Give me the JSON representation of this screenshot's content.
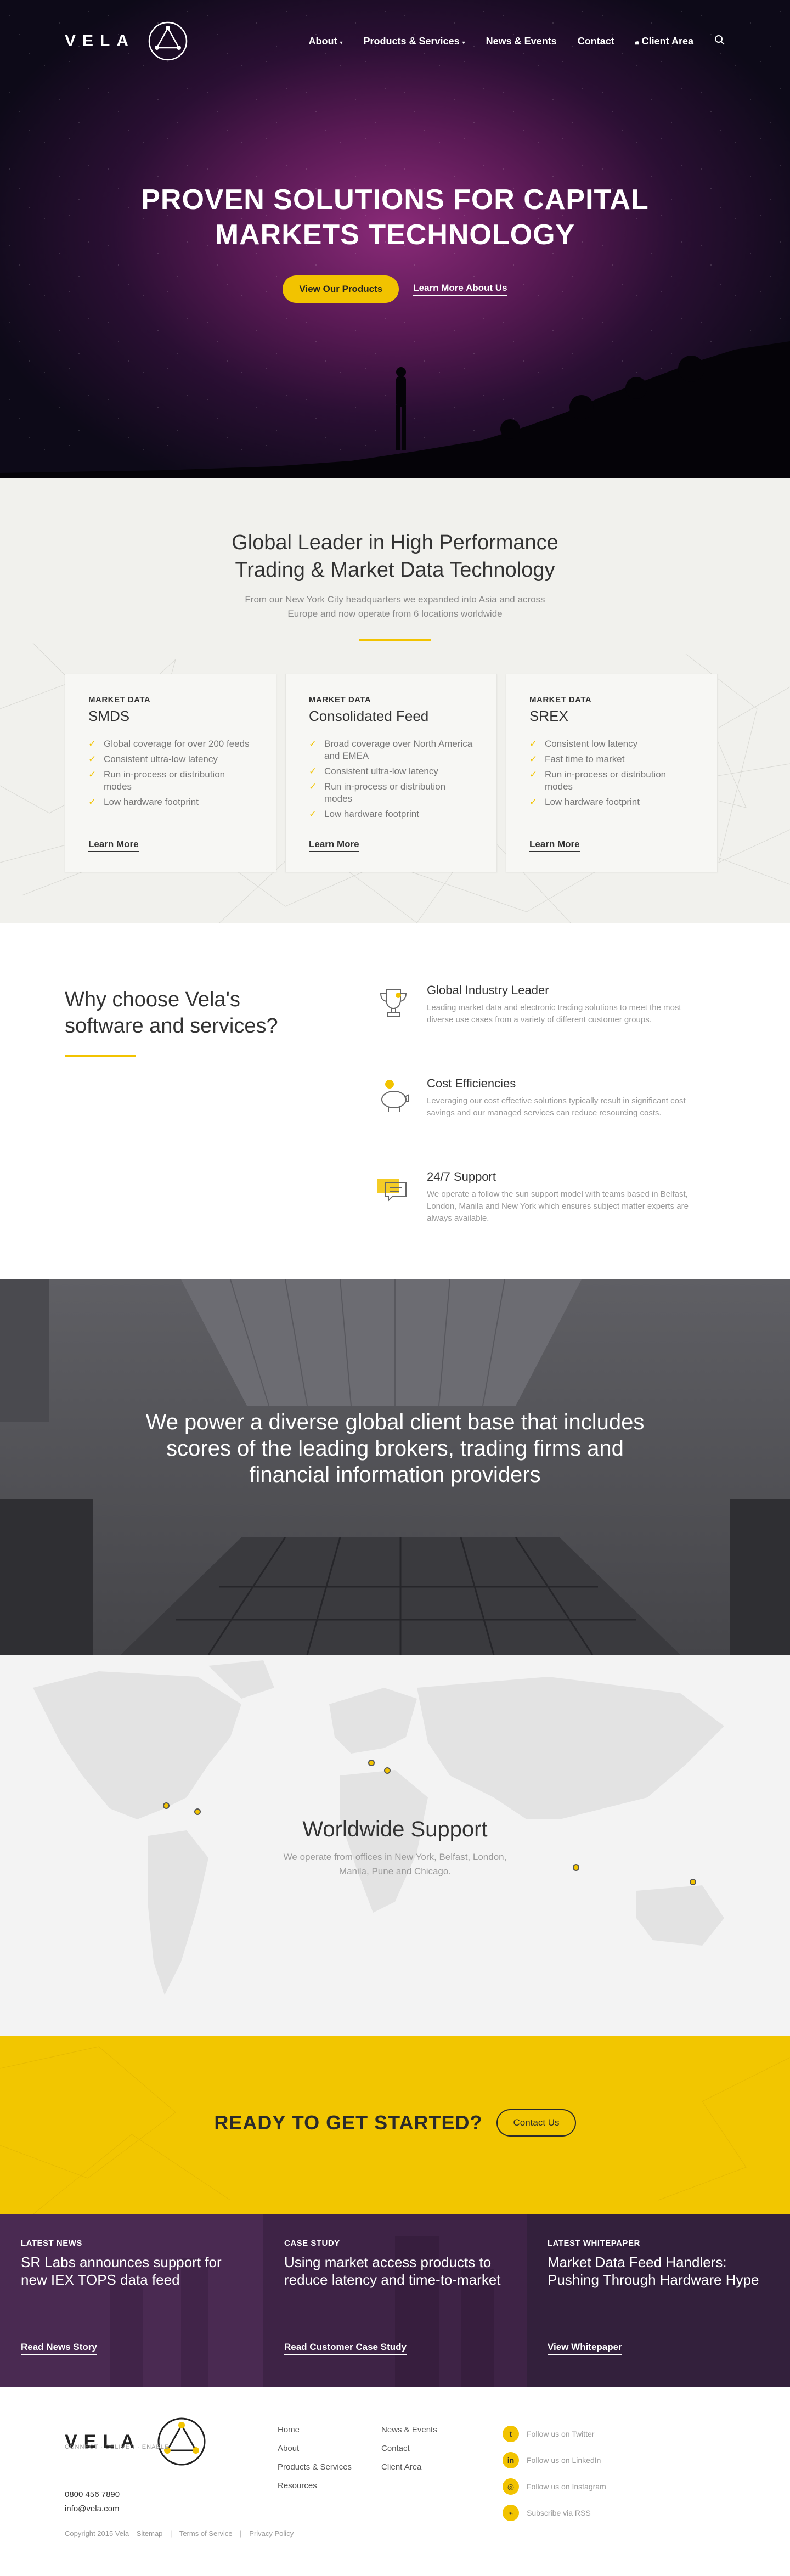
{
  "brand": {
    "name": "VELA",
    "tagline": "CONNECT · DELIVER · ENABLE",
    "trademark": "TM"
  },
  "nav": {
    "about": "About",
    "products": "Products & Services",
    "news": "News & Events",
    "contact": "Contact",
    "client_area": "Client Area"
  },
  "hero": {
    "title_line1": "PROVEN SOLUTIONS FOR CAPITAL",
    "title_line2": "MARKETS TECHNOLOGY",
    "primary_button": "View Our Products",
    "secondary_link": "Learn More About Us"
  },
  "market": {
    "title_line1": "Global Leader in High Performance",
    "title_line2": "Trading & Market Data Technology",
    "sub_line1": "From our New York City headquarters we expanded into Asia and across",
    "sub_line2": "Europe and now operate from 6 locations worldwide",
    "cards": [
      {
        "kicker": "MARKET DATA",
        "title": "SMDS",
        "items": [
          "Global coverage for over 200 feeds",
          "Consistent ultra-low latency",
          "Run in-process or distribution modes",
          "Low hardware footprint"
        ],
        "link": "Learn More"
      },
      {
        "kicker": "MARKET DATA",
        "title": "Consolidated Feed",
        "items": [
          "Broad coverage over North America and EMEA",
          "Consistent ultra-low latency",
          "Run in-process or distribution modes",
          "Low hardware footprint"
        ],
        "link": "Learn More"
      },
      {
        "kicker": "MARKET DATA",
        "title": "SREX",
        "items": [
          "Consistent low latency",
          "Fast time to market",
          "Run in-process or distribution modes",
          "Low hardware footprint"
        ],
        "link": "Learn More"
      }
    ]
  },
  "why": {
    "title_line1": "Why choose Vela's",
    "title_line2": "software and services?",
    "features": [
      {
        "icon": "trophy-icon",
        "title": "Global Industry Leader",
        "desc_line1": "Leading market data and electronic trading solutions to meet the most",
        "desc_line2": "diverse use cases from a variety of different customer groups."
      },
      {
        "icon": "piggy-bank-icon",
        "title": "Cost Efficiencies",
        "desc_line1": "Leveraging our cost effective solutions typically result in significant cost",
        "desc_line2": "savings and our managed services can reduce resourcing costs."
      },
      {
        "icon": "chat-bubbles-icon",
        "title": "24/7 Support",
        "desc_line1": "We operate a follow the sun support model with teams based in Belfast,",
        "desc_line2": "London, Manila and New York which ensures subject matter experts are",
        "desc_line3": "always available."
      }
    ]
  },
  "clients": {
    "line1": "We power a diverse global client base that includes",
    "line2": "scores of the leading brokers, trading firms and",
    "line3": "financial information providers"
  },
  "worldwide": {
    "title": "Worldwide Support",
    "sub_line1": "We operate from offices in New York, Belfast, London,",
    "sub_line2": "Manila, Pune and Chicago."
  },
  "cta": {
    "title": "READY TO GET STARTED?",
    "button": "Contact Us"
  },
  "news": [
    {
      "kicker": "LATEST NEWS",
      "title": "SR Labs announces support for new IEX TOPS data feed",
      "link": "Read News Story"
    },
    {
      "kicker": "CASE STUDY",
      "title": "Using market access products to reduce latency and time-to-market",
      "link": "Read Customer Case Study"
    },
    {
      "kicker": "LATEST WHITEPAPER",
      "title": "Market Data Feed Handlers: Pushing Through Hardware Hype",
      "link": "View Whitepaper"
    }
  ],
  "footer": {
    "phone": "0800 456 7890",
    "email": "info@vela.com",
    "col1": [
      "Home",
      "About",
      "Products & Services",
      "Resources"
    ],
    "col2": [
      "News & Events",
      "Contact",
      "Client Area"
    ],
    "social": [
      {
        "icon": "twitter-icon",
        "glyph": "t",
        "label": "Follow us on Twitter"
      },
      {
        "icon": "linkedin-icon",
        "glyph": "in",
        "label": "Follow us on LinkedIn"
      },
      {
        "icon": "instagram-icon",
        "glyph": "◎",
        "label": "Follow us on Instagram"
      },
      {
        "icon": "rss-icon",
        "glyph": "⌁",
        "label": "Subscribe via RSS"
      }
    ],
    "copyright": "Copyright 2015 Vela",
    "sitemap": "Sitemap",
    "terms": "Terms of Service",
    "privacy": "Privacy Policy"
  },
  "colors": {
    "accent": "#f2c300",
    "news_purple": "#4a2a52",
    "text_dark": "#333333"
  }
}
